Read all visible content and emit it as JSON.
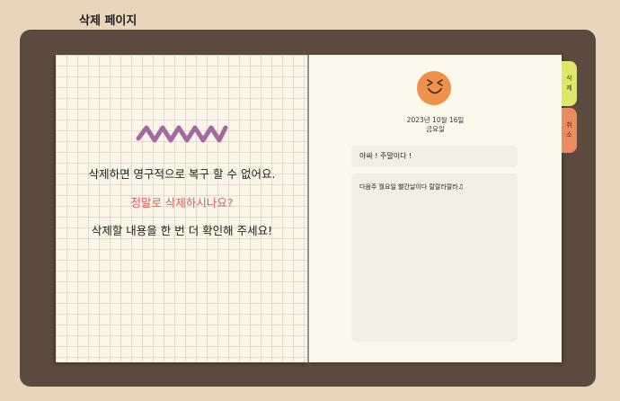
{
  "page": {
    "title": "삭제 페이지"
  },
  "left_page": {
    "message_1": "삭제하면 영구적으로 복구 할 수 없어요.",
    "message_2": "정말로 삭제하시나요?",
    "message_3": "삭제할 내용을 한 번 더 확인해 주세요!"
  },
  "right_page": {
    "date": "2023년 10월 16일",
    "weekday": "금요일",
    "entry_title": "아싸 ! 주말이다 !",
    "entry_content": "다음주 월요일 빨간날이다 랄랄라랄라♫"
  },
  "tabs": {
    "delete_1": "삭",
    "delete_2": "제",
    "cancel_1": "취",
    "cancel_2": "소"
  },
  "colors": {
    "background": "#e9d4bc",
    "frame": "#5c4a40",
    "warning_text": "#d86060",
    "delete_tab": "#dee766",
    "cancel_tab": "#ec8b5c",
    "avatar": "#f0904a",
    "zigzag": "#a46aa0"
  },
  "icons": {
    "avatar": "laughing-face-icon",
    "decoration": "zigzag-icon"
  }
}
